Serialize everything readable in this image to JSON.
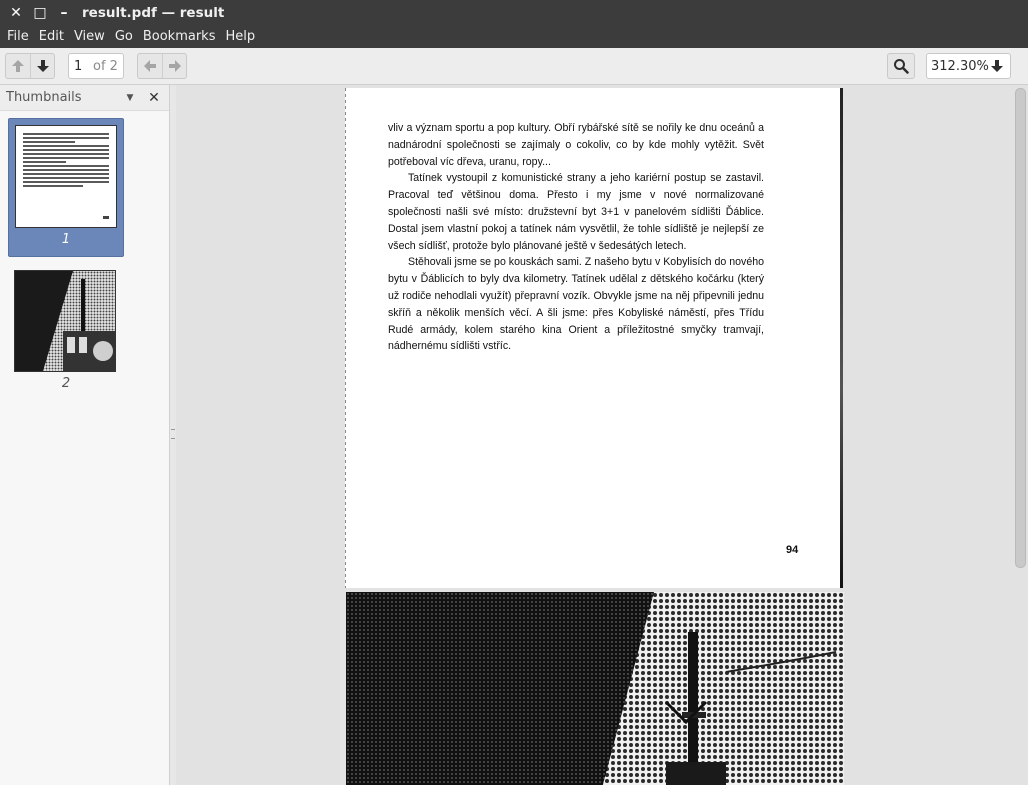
{
  "window": {
    "title": "result.pdf — result",
    "close_glyph": "✕",
    "maximize_glyph": "□",
    "minimize_glyph": "–"
  },
  "menu": [
    "File",
    "Edit",
    "View",
    "Go",
    "Bookmarks",
    "Help"
  ],
  "toolbar": {
    "page_current": "1",
    "page_of": "of 2",
    "zoom": "312.30%",
    "icons": [
      "arrow-up-icon",
      "arrow-down-icon",
      "arrow-left-icon",
      "arrow-right-icon",
      "search-icon",
      "zoom-dropdown-icon"
    ]
  },
  "sidebar": {
    "title": "Thumbnails",
    "thumbnails": [
      {
        "label": "1",
        "selected": true
      },
      {
        "label": "2",
        "selected": false
      }
    ]
  },
  "document": {
    "page1": {
      "paragraphs": [
        "vliv a význam sportu a pop kultury. Obří rybářské sítě se nořily ke dnu oceánů a nadnárodní společnosti se zajímaly o cokoliv, co by kde mohly vytěžit. Svět potřeboval víc dřeva, uranu, ropy...",
        "Tatínek vystoupil z komunistické strany a jeho kariérní postup se zastavil. Pracoval teď většinou doma. Přesto i my jsme v nové normalizované společnosti našli své místo: družstevní byt 3+1 v panelovém sídlišti Ďáblice. Dostal jsem vlastní pokoj a tatínek nám vysvětlil, že tohle sídliště je nejlepší ze všech sídlišť, protože bylo plánované ještě v šedesátých letech.",
        "Stěhovali jsme se po kouskách sami. Z našeho bytu v Kobylisích do nového bytu v Ďáblicích to byly dva kilometry. Tatínek udělal z dětského kočárku (který už rodiče nehodlali využít) přepravní vozík. Obvykle jsme na něj připevnili jednu skříň a několik menších věcí. A šli jsme: přes Kobyliské náměstí, přes Třídu Rudé armády, kolem starého kina Orient a příležitostné smyčky tramvají, nádhernému sídlišti vstříc."
      ],
      "page_number": "94"
    }
  }
}
